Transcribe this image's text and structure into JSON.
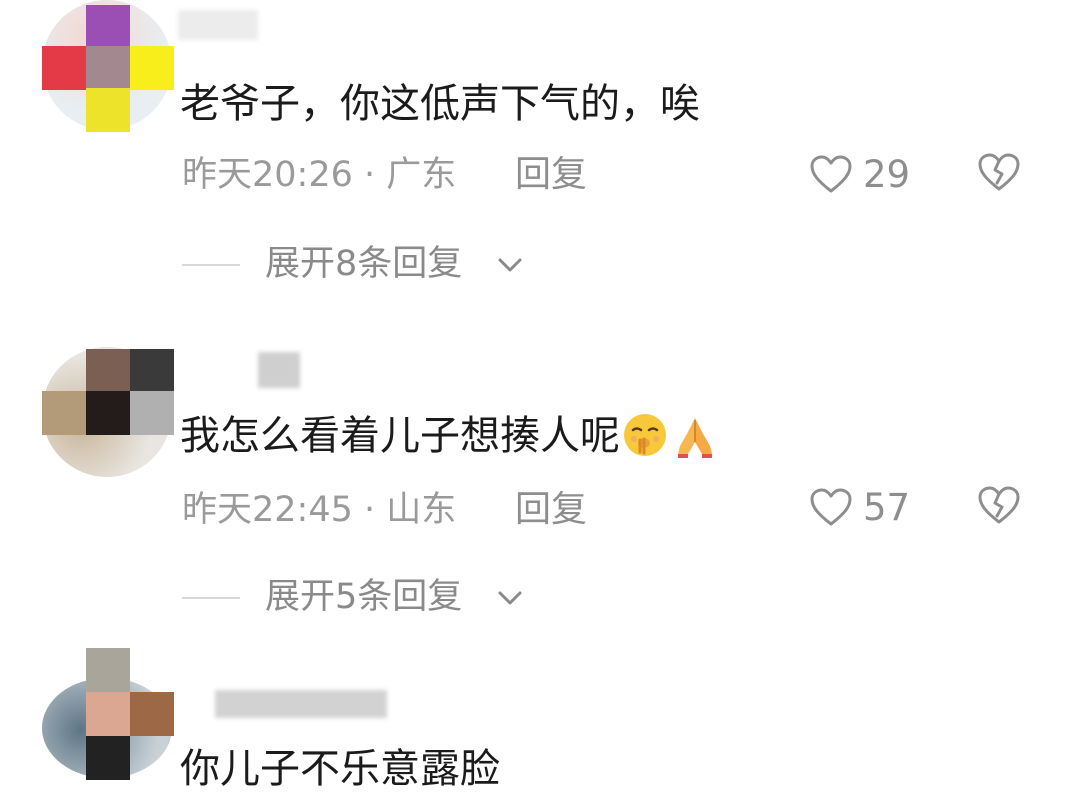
{
  "comments": [
    {
      "text": "老爷子，你这低声下气的，唉",
      "time_location": "昨天20:26 · 广东",
      "reply_label": "回复",
      "likes": "29",
      "expand_label": "展开8条回复"
    },
    {
      "text": "我怎么看着儿子想揍人呢",
      "time_location": "昨天22:45 · 山东",
      "reply_label": "回复",
      "likes": "57",
      "expand_label": "展开5条回复"
    },
    {
      "text": "你儿子不乐意露脸"
    }
  ],
  "icons": {
    "like": "heart-outline-icon",
    "dislike": "broken-heart-icon",
    "expand": "chevron-down-icon",
    "emoji_1": "shushing-face-emoji",
    "emoji_2": "folded-hands-emoji"
  },
  "colors": {
    "text": "#1b1b1b",
    "meta": "#9a9a9a"
  }
}
